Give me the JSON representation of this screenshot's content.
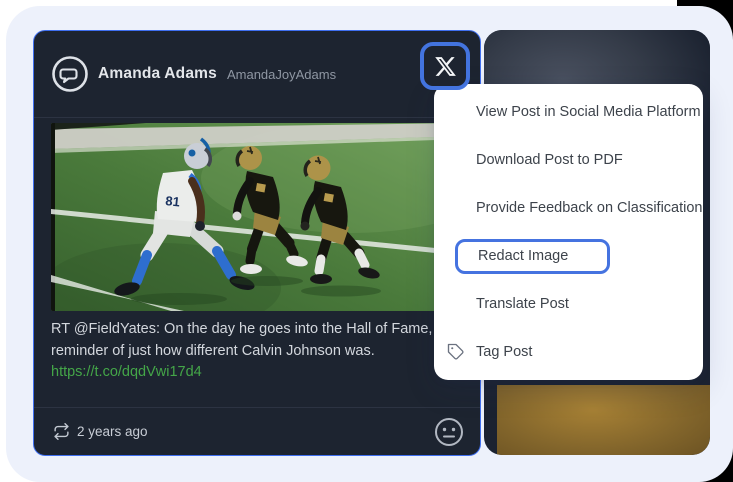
{
  "colors": {
    "accent_blue": "#4573e0",
    "card_background": "#1d2430",
    "card_border_blue": "#3f6ff0",
    "container_background": "#edf1fb",
    "link_green": "#44a648",
    "menu_background": "#ffffff",
    "menu_text": "#3d434b",
    "text_primary": "#e3e6ea",
    "text_secondary": "#8f97a3"
  },
  "post": {
    "author_name": "Amanda Adams",
    "author_handle": "AmandaJoyAdams",
    "avatar_icon": "speech-bubble-icon",
    "platform_icon": "x-twitter-icon",
    "body": "RT @FieldYates: On the day he goes into the Hall of Fame, a reminder of just how different Calvin Johnson was.",
    "link_text": "https://t.co/dqdVwi17d4",
    "timestamp": "2 years ago",
    "timestamp_icon": "retweet-icon",
    "sentiment_icon": "neutral-face-icon",
    "image_description": "NFL play: a Detroit Lions receiver in white and blue lined up across from two New Orleans Saints defenders in black and gold on a green field with white yard lines"
  },
  "menu": {
    "items": [
      {
        "label": "View Post in Social Media Platform",
        "highlighted": false
      },
      {
        "label": "Download Post to PDF",
        "highlighted": false
      },
      {
        "label": "Provide Feedback on Classification",
        "highlighted": false
      },
      {
        "label": "Redact Image",
        "highlighted": true
      },
      {
        "label": "Translate Post",
        "highlighted": false
      },
      {
        "label": "Tag Post",
        "highlighted": false,
        "icon": "tag-icon"
      }
    ]
  }
}
